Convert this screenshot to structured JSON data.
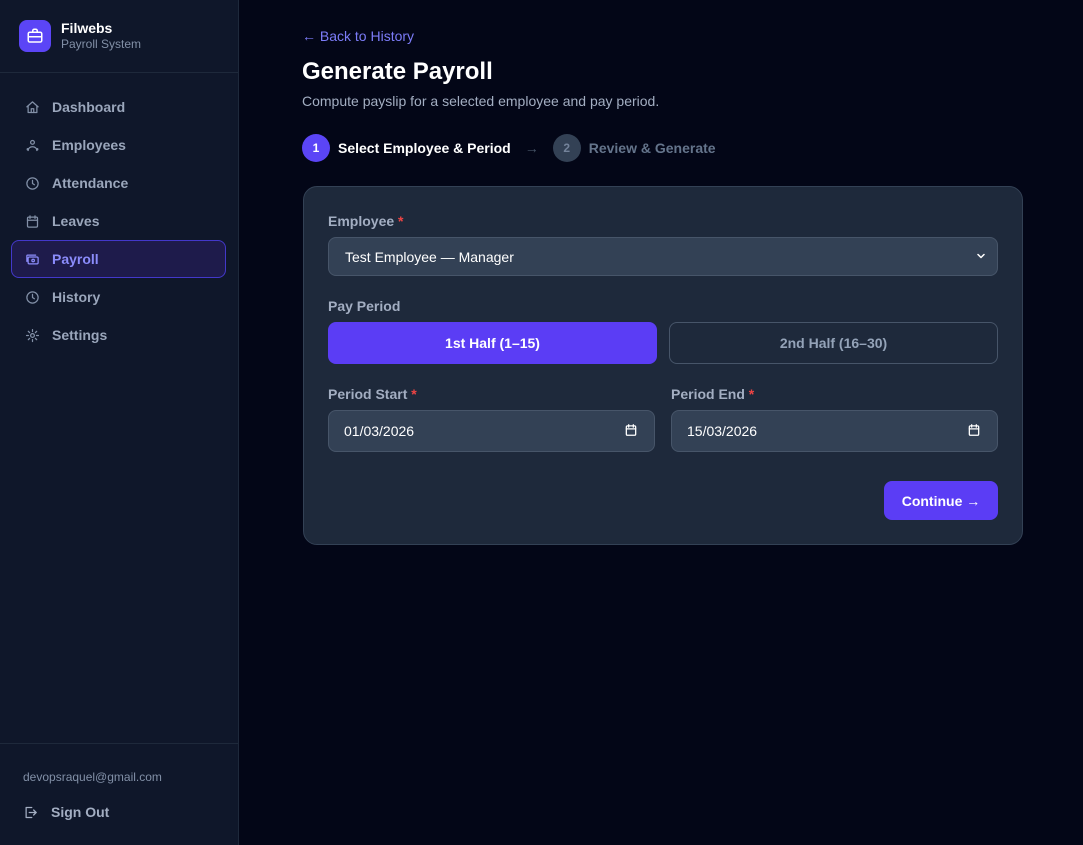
{
  "brand": {
    "name": "Filwebs",
    "subtitle": "Payroll System",
    "icon": "briefcase-icon",
    "accent": "#5b45f6"
  },
  "sidebar": {
    "items": [
      {
        "label": "Dashboard",
        "icon": "home-icon",
        "active": false
      },
      {
        "label": "Employees",
        "icon": "users-icon",
        "active": false
      },
      {
        "label": "Attendance",
        "icon": "clock-icon",
        "active": false
      },
      {
        "label": "Leaves",
        "icon": "calendar-icon",
        "active": false
      },
      {
        "label": "Payroll",
        "icon": "wallet-icon",
        "active": true
      },
      {
        "label": "History",
        "icon": "history-icon",
        "active": false
      },
      {
        "label": "Settings",
        "icon": "gear-icon",
        "active": false
      }
    ],
    "user_email": "devopsraquel@gmail.com",
    "sign_out": "Sign Out"
  },
  "header": {
    "back_link": "← Back to History",
    "title": "Generate Payroll",
    "subtitle": "Compute payslip for a selected employee and pay period."
  },
  "steps": [
    {
      "number": "1",
      "label": "Select Employee & Period",
      "active": true
    },
    {
      "number": "2",
      "label": "Review & Generate",
      "active": false
    }
  ],
  "step_separator": "→",
  "form": {
    "employee": {
      "label": "Employee",
      "required_mark": "*",
      "value": "Test Employee — Manager"
    },
    "pay_period": {
      "label": "Pay Period",
      "options": [
        "1st Half (1–15)",
        "2nd Half (16–30)"
      ],
      "selected": "1st Half (1–15)"
    },
    "period_start": {
      "label": "Period Start",
      "required_mark": "*",
      "value": "01/03/2026"
    },
    "period_end": {
      "label": "Period End",
      "required_mark": "*",
      "value": "15/03/2026"
    },
    "continue_label": "Continue →"
  },
  "colors": {
    "primary": "#5b3df5",
    "background": "#030617",
    "sidebar": "#0f172a",
    "card": "#1e293b",
    "required": "#ef4444"
  }
}
